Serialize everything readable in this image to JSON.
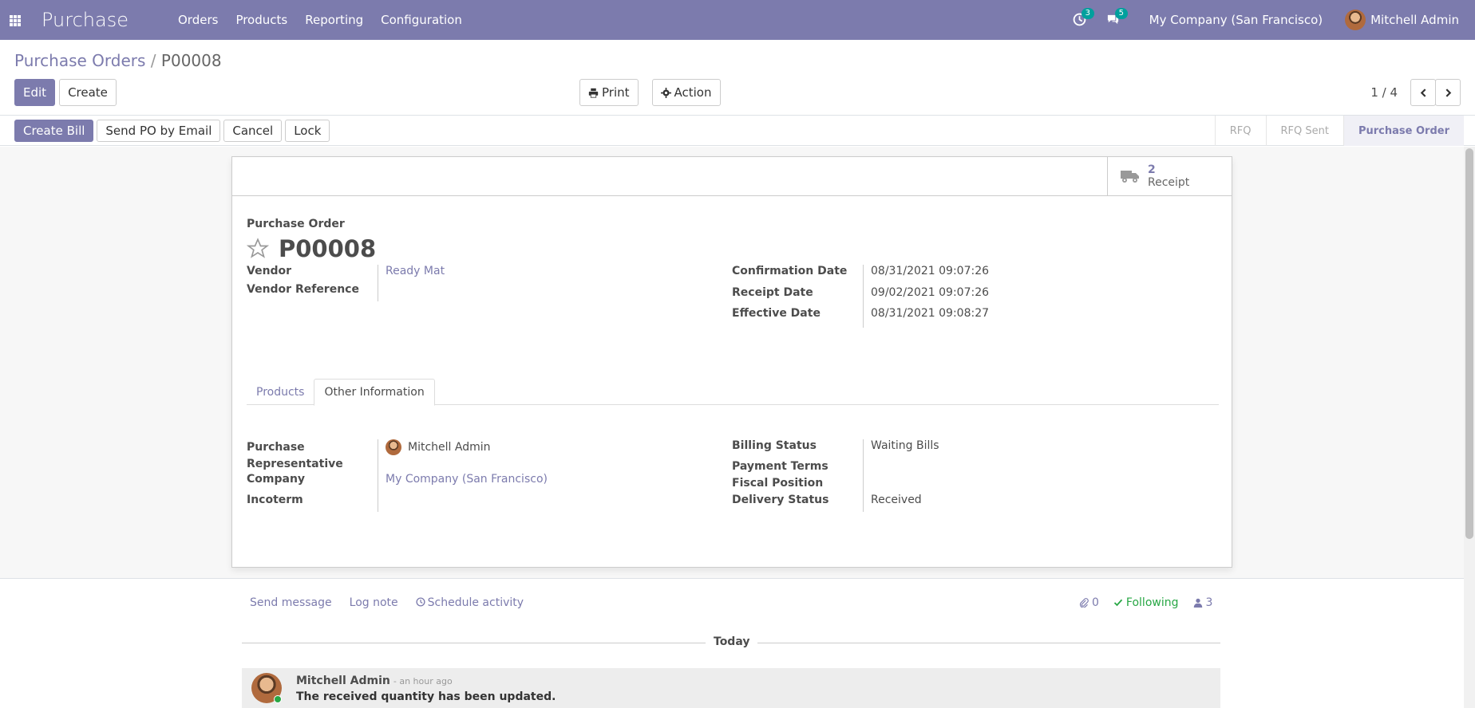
{
  "navbar": {
    "brand": "Purchase",
    "menu": [
      "Orders",
      "Products",
      "Reporting",
      "Configuration"
    ],
    "activity_count": "3",
    "message_count": "5",
    "company": "My Company (San Francisco)",
    "user": "Mitchell Admin"
  },
  "control": {
    "breadcrumb_parent": "Purchase Orders",
    "breadcrumb_sep": "/",
    "breadcrumb_current": "P00008",
    "edit_label": "Edit",
    "create_label": "Create",
    "print_label": "Print",
    "action_label": "Action",
    "pager_value": "1 / 4"
  },
  "statusbar": {
    "actions": [
      "Create Bill",
      "Send PO by Email",
      "Cancel",
      "Lock"
    ],
    "stages": [
      "RFQ",
      "RFQ Sent",
      "Purchase Order"
    ],
    "active_stage": "Purchase Order"
  },
  "sheet": {
    "smart_button": {
      "value": "2",
      "label": "Receipt"
    },
    "order_label": "Purchase Order",
    "order_name": "P00008",
    "left_fields": [
      {
        "label": "Vendor",
        "value": "Ready Mat"
      },
      {
        "label": "Vendor Reference",
        "value": ""
      }
    ],
    "right_fields": [
      {
        "label": "Confirmation Date",
        "value": "08/31/2021 09:07:26"
      },
      {
        "label": "Receipt Date",
        "value": "09/02/2021 09:07:26"
      },
      {
        "label": "Effective Date",
        "value": "08/31/2021 09:08:27"
      }
    ],
    "tabs": [
      "Products",
      "Other Information"
    ],
    "other_left": [
      {
        "label_line1": "Purchase",
        "label_line2": "Representative",
        "value": "Mitchell Admin"
      },
      {
        "label": "Company",
        "value": "My Company (San Francisco)"
      },
      {
        "label": "Incoterm",
        "value": ""
      }
    ],
    "other_right": [
      {
        "label": "Billing Status",
        "value": "Waiting Bills"
      },
      {
        "label": "Payment Terms",
        "value": ""
      },
      {
        "label": "Fiscal Position",
        "value": ""
      },
      {
        "label": "Delivery Status",
        "value": "Received"
      }
    ]
  },
  "chatter": {
    "send_message": "Send message",
    "log_note": "Log note",
    "schedule_activity": "Schedule activity",
    "attachments": "0",
    "following": "Following",
    "followers": "3",
    "date_separator": "Today",
    "message": {
      "author": "Mitchell Admin",
      "time": "- an hour ago",
      "body": "The received quantity has been updated."
    }
  },
  "colors": {
    "brand": "#7c7bad",
    "success": "#28a745",
    "badge": "#00a09d"
  }
}
